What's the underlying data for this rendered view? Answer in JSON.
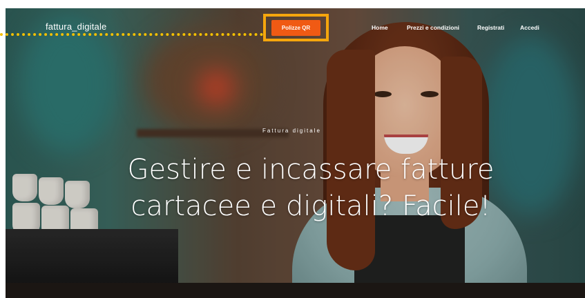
{
  "header": {
    "logo": "fattura_digitale",
    "cta_label": "Polizze QR",
    "nav": [
      {
        "label": "Home"
      },
      {
        "label": "Prezzi e condizioni"
      },
      {
        "label": "Registrati"
      },
      {
        "label": "Accedi"
      }
    ]
  },
  "hero": {
    "eyebrow": "Fattura digitale",
    "headline_line1": "Gestire e incassare fatture",
    "headline_line2": "cartacee e digitali? Facile!"
  },
  "colors": {
    "cta": "#f05a14",
    "highlight": "#f5a60d",
    "dots": "#f5c000"
  }
}
